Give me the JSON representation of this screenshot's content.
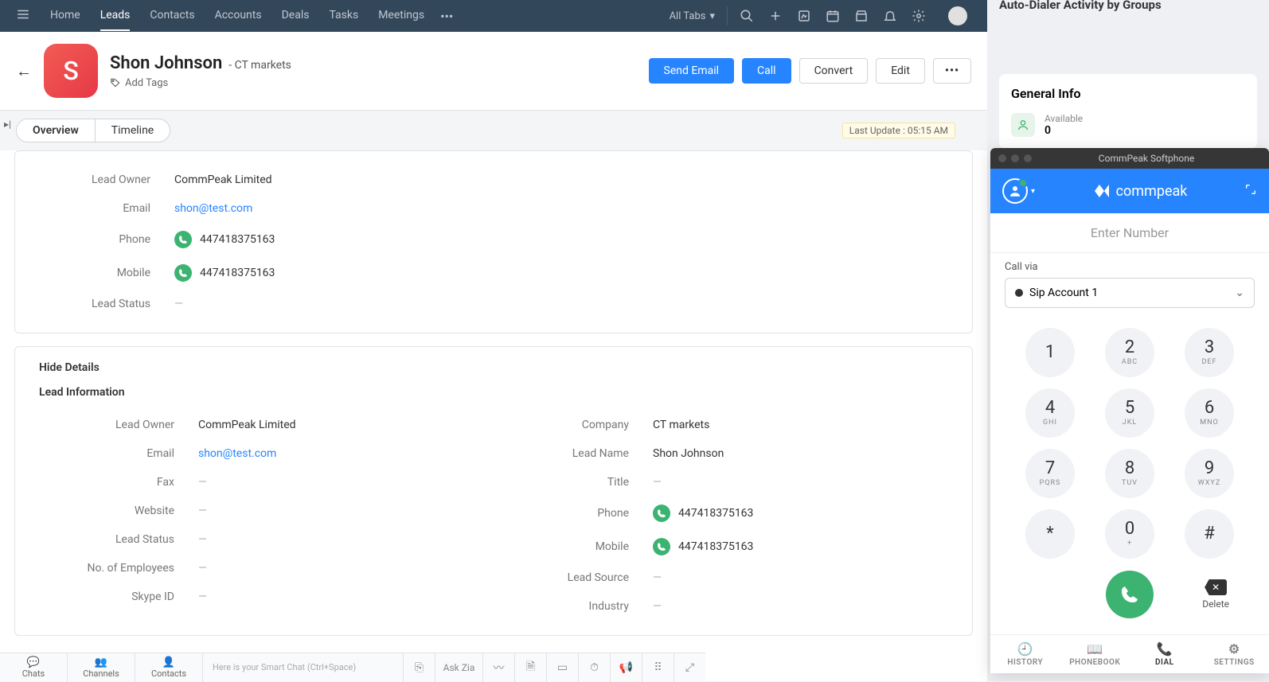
{
  "nav": {
    "tabs": [
      "Home",
      "Leads",
      "Contacts",
      "Accounts",
      "Deals",
      "Tasks",
      "Meetings"
    ],
    "active_index": 1,
    "all_tabs_label": "All Tabs"
  },
  "header": {
    "lead_initial": "S",
    "lead_name": "Shon Johnson",
    "company_suffix": "- CT markets",
    "add_tags_label": "Add Tags",
    "actions": {
      "send_email": "Send Email",
      "call": "Call",
      "convert": "Convert",
      "edit": "Edit",
      "more": "•••"
    }
  },
  "subnav": {
    "overview": "Overview",
    "timeline": "Timeline",
    "last_update": "Last Update : 05:15 AM"
  },
  "overview_fields": {
    "lead_owner_label": "Lead Owner",
    "lead_owner_value": "CommPeak Limited",
    "email_label": "Email",
    "email_value": "shon@test.com",
    "phone_label": "Phone",
    "phone_value": "447418375163",
    "mobile_label": "Mobile",
    "mobile_value": "447418375163",
    "lead_status_label": "Lead Status",
    "lead_status_value": "—"
  },
  "details": {
    "hide_label": "Hide Details",
    "section_title": "Lead Information",
    "left": [
      {
        "label": "Lead Owner",
        "value": "CommPeak Limited",
        "type": "text"
      },
      {
        "label": "Email",
        "value": "shon@test.com",
        "type": "link"
      },
      {
        "label": "Fax",
        "value": "—",
        "type": "empty"
      },
      {
        "label": "Website",
        "value": "—",
        "type": "empty"
      },
      {
        "label": "Lead Status",
        "value": "—",
        "type": "empty"
      },
      {
        "label": "No. of Employees",
        "value": "—",
        "type": "empty"
      },
      {
        "label": "Skype ID",
        "value": "—",
        "type": "empty"
      }
    ],
    "right": [
      {
        "label": "Company",
        "value": "CT markets",
        "type": "text"
      },
      {
        "label": "Lead Name",
        "value": "Shon Johnson",
        "type": "text"
      },
      {
        "label": "Title",
        "value": "—",
        "type": "empty"
      },
      {
        "label": "Phone",
        "value": "447418375163",
        "type": "phone"
      },
      {
        "label": "Mobile",
        "value": "447418375163",
        "type": "phone"
      },
      {
        "label": "Lead Source",
        "value": "—",
        "type": "empty"
      },
      {
        "label": "Industry",
        "value": "—",
        "type": "empty"
      }
    ]
  },
  "bottom": {
    "tabs": [
      "Chats",
      "Channels",
      "Contacts"
    ],
    "smart_chat_placeholder": "Here is your Smart Chat (Ctrl+Space)",
    "ask_zia": "Ask Zia"
  },
  "right_panel": {
    "auto_dialer_title": "Auto-Dialer Activity by Groups",
    "general_info_title": "General Info",
    "available_label": "Available",
    "available_value": "0"
  },
  "softphone": {
    "window_title": "CommPeak Softphone",
    "logo_text": "commpeak",
    "number_placeholder": "Enter Number",
    "call_via_label": "Call via",
    "account_name": "Sip Account 1",
    "keypad": [
      {
        "num": "1",
        "sub": ""
      },
      {
        "num": "2",
        "sub": "ABC"
      },
      {
        "num": "3",
        "sub": "DEF"
      },
      {
        "num": "4",
        "sub": "GHI"
      },
      {
        "num": "5",
        "sub": "JKL"
      },
      {
        "num": "6",
        "sub": "MNO"
      },
      {
        "num": "7",
        "sub": "PQRS"
      },
      {
        "num": "8",
        "sub": "TUV"
      },
      {
        "num": "9",
        "sub": "WXYZ"
      },
      {
        "num": "*",
        "sub": ""
      },
      {
        "num": "0",
        "sub": "+"
      },
      {
        "num": "#",
        "sub": ""
      }
    ],
    "delete_label": "Delete",
    "nav": [
      "HISTORY",
      "PHONEBOOK",
      "DIAL",
      "SETTINGS"
    ],
    "nav_active_index": 2
  }
}
